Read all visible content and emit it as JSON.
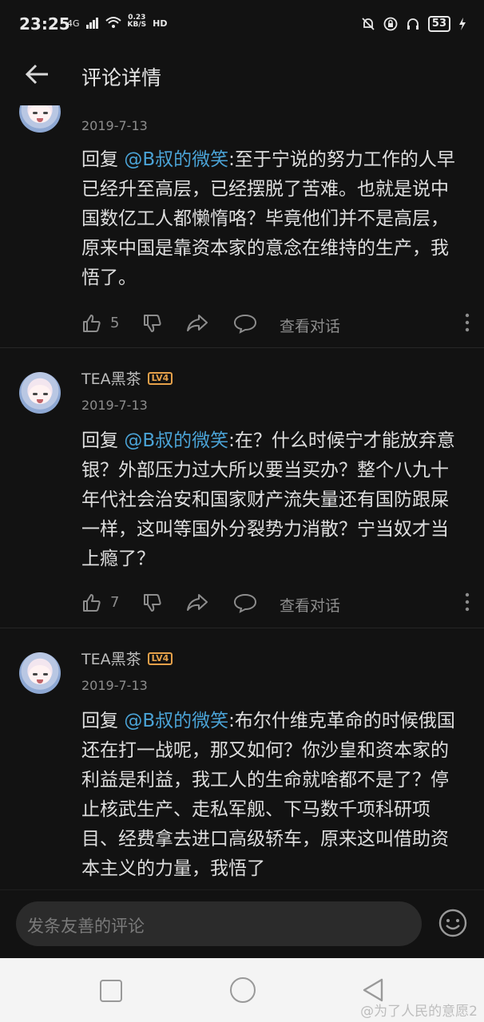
{
  "status_bar": {
    "time": "23:25",
    "network": "4G",
    "speed_value": "0.23",
    "speed_unit": "KB/S",
    "hd": "HD",
    "battery": "53"
  },
  "header": {
    "title": "评论详情"
  },
  "comments": [
    {
      "date": "2019-7-13",
      "reply_prefix": "回复 ",
      "mention": "@B叔的微笑",
      "body": ":至于宁说的努力工作的人早已经升至高层，已经摆脱了苦难。也就是说中国数亿工人都懒惰咯？毕竟他们并不是高层，原来中国是靠资本家的意念在维持的生产，我悟了。",
      "likes": "5",
      "conversation": "查看对话"
    },
    {
      "username": "TEA黑茶",
      "level": "LV4",
      "date": "2019-7-13",
      "reply_prefix": "回复 ",
      "mention": "@B叔的微笑",
      "body": ":在？什么时候宁才能放弃意银？外部压力过大所以要当买办？整个八九十年代社会治安和国家财产流失量还有国防跟屎一样，这叫等国外分裂势力消散？宁当奴才当上瘾了？",
      "likes": "7",
      "conversation": "查看对话"
    },
    {
      "username": "TEA黑茶",
      "level": "LV4",
      "date": "2019-7-13",
      "reply_prefix": "回复 ",
      "mention": "@B叔的微笑",
      "body": ":布尔什维克革命的时候俄国还在打一战呢，那又如何？你沙皇和资本家的利益是利益，我工人的生命就啥都不是了？停止核武生产、走私军舰、下马数千项科研项目、经费拿去进口高级轿车，原来这叫借助资本主义的力量，我悟了"
    }
  ],
  "input": {
    "placeholder": "发条友善的评论"
  },
  "watermark": "@为了人民的意愿2"
}
